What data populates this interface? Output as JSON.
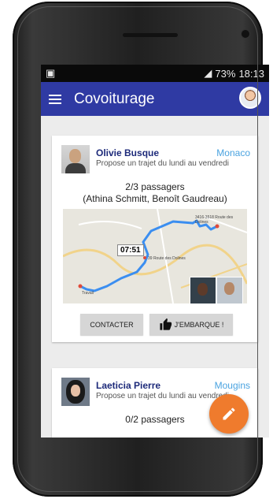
{
  "status": {
    "battery": "73%",
    "time": "18:13"
  },
  "appbar": {
    "title": "Covoiturage"
  },
  "trips": [
    {
      "driver": "Olivie Busque",
      "city": "Monaco",
      "description": "Propose un trajet du lundi au vendredi",
      "passengers_count": "2/3 passagers",
      "passengers_names": "(Athina Schmitt, Benoît Gaudreau)",
      "map": {
        "time": "07:51",
        "label_start": "3416-3518 Route des Dolines",
        "label_mid": "39 Route des Dolines",
        "label_end": "Travail"
      },
      "contact_label": "CONTACTER",
      "join_label": "J'EMBARQUE !"
    },
    {
      "driver": "Laeticia Pierre",
      "city": "Mougins",
      "description": "Propose un trajet du lundi au vendredi",
      "passengers_count": "0/2 passagers"
    }
  ],
  "icons": {
    "menu": "hamburger-menu-icon",
    "thumb": "thumbs-up-icon",
    "fab": "pencil-icon"
  },
  "colors": {
    "appbar": "#2f3aa3",
    "accent": "#ef7b2d",
    "city": "#4aa3e0"
  }
}
